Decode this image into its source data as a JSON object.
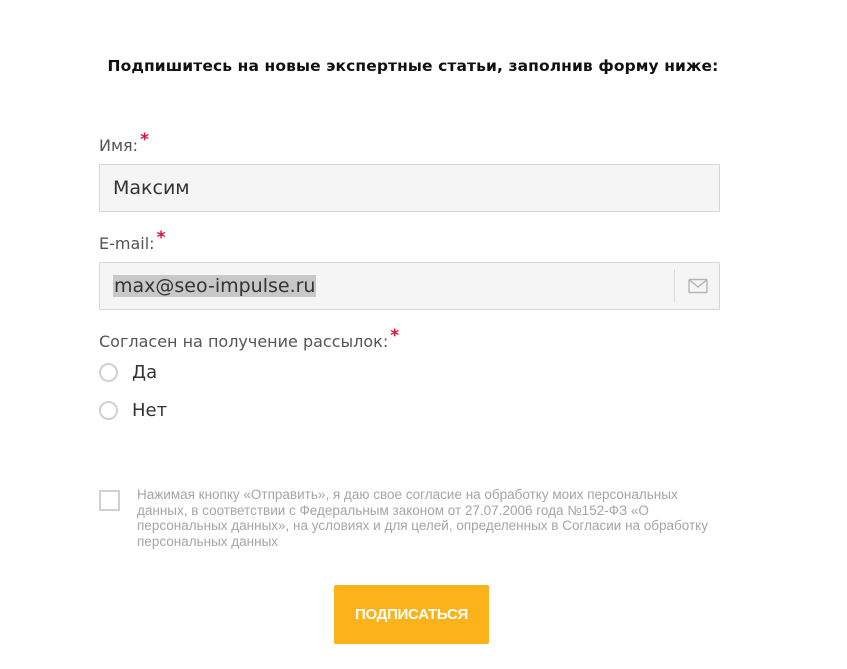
{
  "form": {
    "heading": "Подпишитесь на новые экспертные статьи, заполнив форму ниже:",
    "name_field": {
      "label": "Имя:",
      "required_mark": "*",
      "value": "Максим"
    },
    "email_field": {
      "label": "E-mail:",
      "required_mark": "*",
      "value": "max@seo-impulse.ru",
      "icon": "envelope-icon"
    },
    "subscription_consent": {
      "label": "Согласен на получение рассылок:",
      "required_mark": "*",
      "options": [
        {
          "label": "Да",
          "selected": false
        },
        {
          "label": "Нет",
          "selected": false
        }
      ]
    },
    "personal_data_consent": {
      "checked": false,
      "text": "Нажимая кнопку «Отправить», я даю свое согласие на обработку моих персональных данных, в соответствии с Федеральным законом от 27.07.2006 года №152-ФЗ «О персональных данных», на условиях и для целей, определенных в Согласии на обработку персональных данных"
    },
    "submit_label": "ПОДПИСАТЬСЯ"
  },
  "colors": {
    "required": "#e0103a",
    "button": "#fcb21b",
    "field_bg": "#f5f5f5",
    "border": "#d6d6d6"
  }
}
